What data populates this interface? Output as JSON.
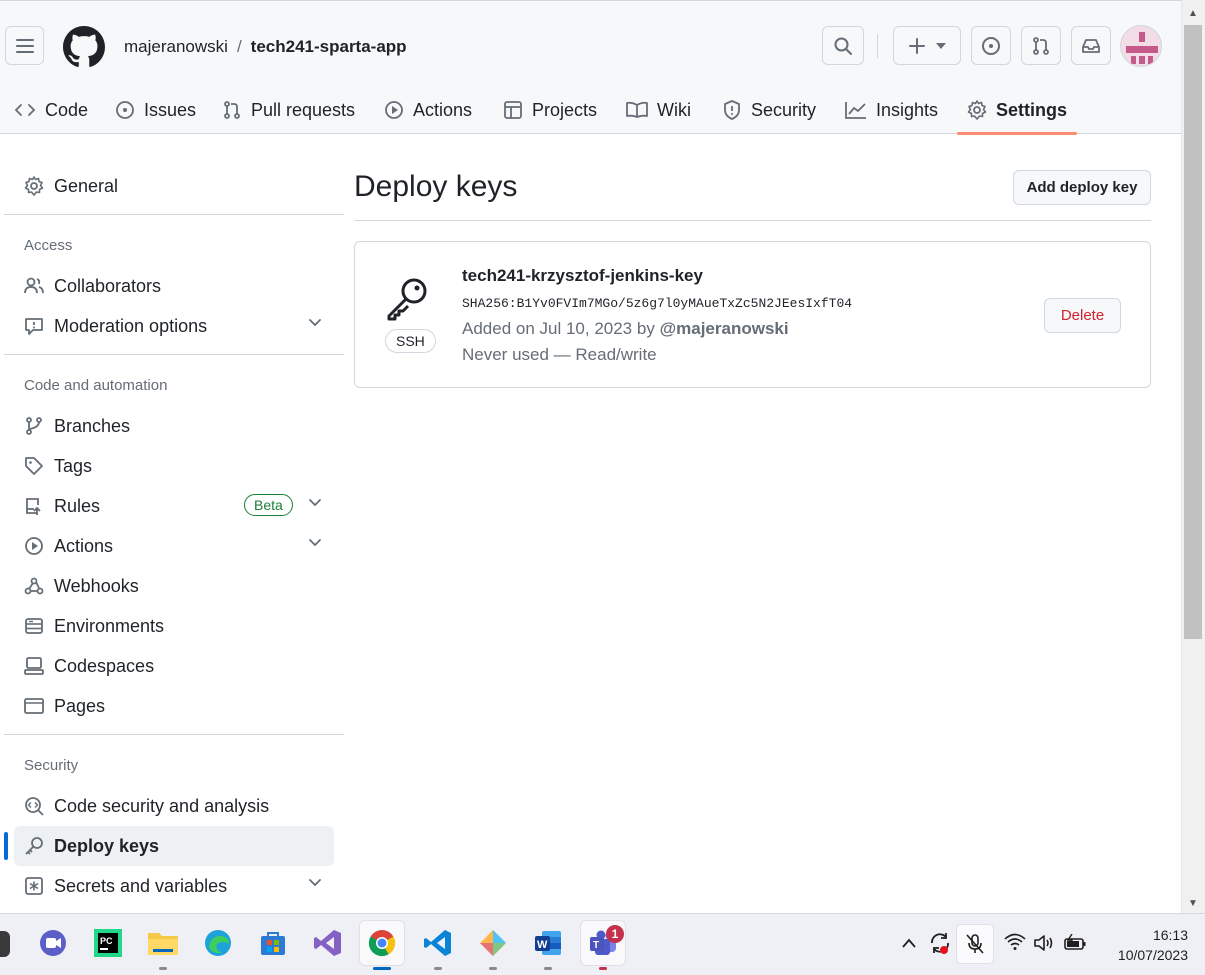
{
  "header": {
    "owner": "majeranowski",
    "separator": "/",
    "repo": "tech241-sparta-app"
  },
  "tabs": [
    {
      "label": "Code",
      "icon": "code-icon"
    },
    {
      "label": "Issues",
      "icon": "issue-icon"
    },
    {
      "label": "Pull requests",
      "icon": "pull-request-icon"
    },
    {
      "label": "Actions",
      "icon": "play-icon"
    },
    {
      "label": "Projects",
      "icon": "table-icon"
    },
    {
      "label": "Wiki",
      "icon": "book-icon"
    },
    {
      "label": "Security",
      "icon": "shield-icon"
    },
    {
      "label": "Insights",
      "icon": "graph-icon"
    },
    {
      "label": "Settings",
      "icon": "gear-icon",
      "active": true
    }
  ],
  "sidebar": {
    "general": "General",
    "access_heading": "Access",
    "collaborators": "Collaborators",
    "moderation": "Moderation options",
    "code_heading": "Code and automation",
    "branches": "Branches",
    "tags": "Tags",
    "rules": "Rules",
    "beta": "Beta",
    "actions": "Actions",
    "webhooks": "Webhooks",
    "environments": "Environments",
    "codespaces": "Codespaces",
    "pages": "Pages",
    "security_heading": "Security",
    "code_security": "Code security and analysis",
    "deploy_keys": "Deploy keys",
    "secrets": "Secrets and variables"
  },
  "main": {
    "title": "Deploy keys",
    "add_button": "Add deploy key",
    "key": {
      "type": "SSH",
      "name": "tech241-krzysztof-jenkins-key",
      "fingerprint": "SHA256:B1Yv0FVIm7MGo/5z6g7l0yMAueTxZc5N2JEesIxfT04",
      "added_prefix": "Added on Jul 10, 2023 by",
      "added_by": "@majeranowski",
      "usage": "Never used — Read/write",
      "delete_label": "Delete"
    }
  },
  "taskbar": {
    "notification_count": "1",
    "time": "16:13",
    "date": "10/07/2023"
  },
  "colors": {
    "accent": "#0969da",
    "danger": "#cf222e",
    "success": "#1a7f37",
    "tab_underline": "#fd8c73"
  }
}
